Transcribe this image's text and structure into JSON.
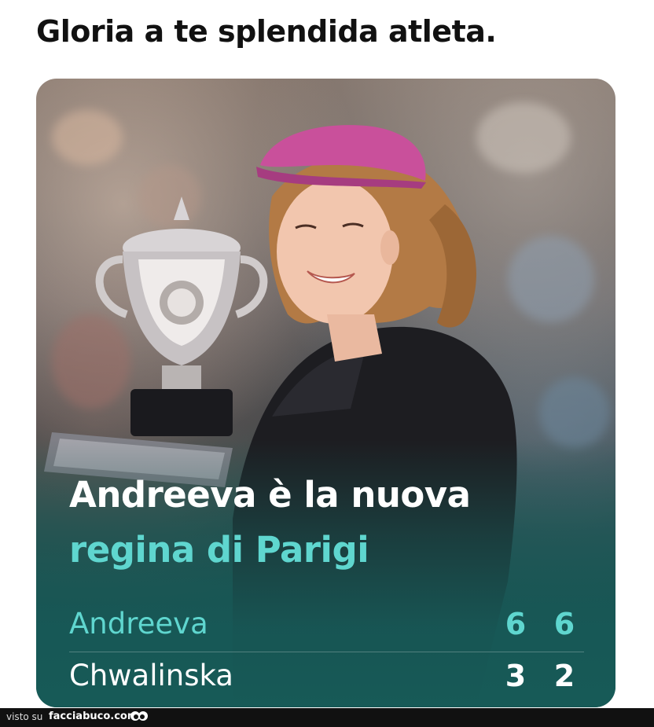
{
  "caption": "Gloria a te splendida atleta.",
  "card": {
    "headline_line1": "Andreeva è la nuova",
    "headline_line2": "regina di Parigi",
    "accent_color": "#5fd6cf",
    "background_color": "#175a57",
    "score": {
      "rows": [
        {
          "player": "Andreeva",
          "sets": [
            "6",
            "6"
          ]
        },
        {
          "player": "Chwalinska",
          "sets": [
            "3",
            "2"
          ]
        }
      ]
    }
  },
  "footer": {
    "prefix": "visto su",
    "site": "facciabuco.com",
    "logo_icon": "eyes-icon"
  }
}
